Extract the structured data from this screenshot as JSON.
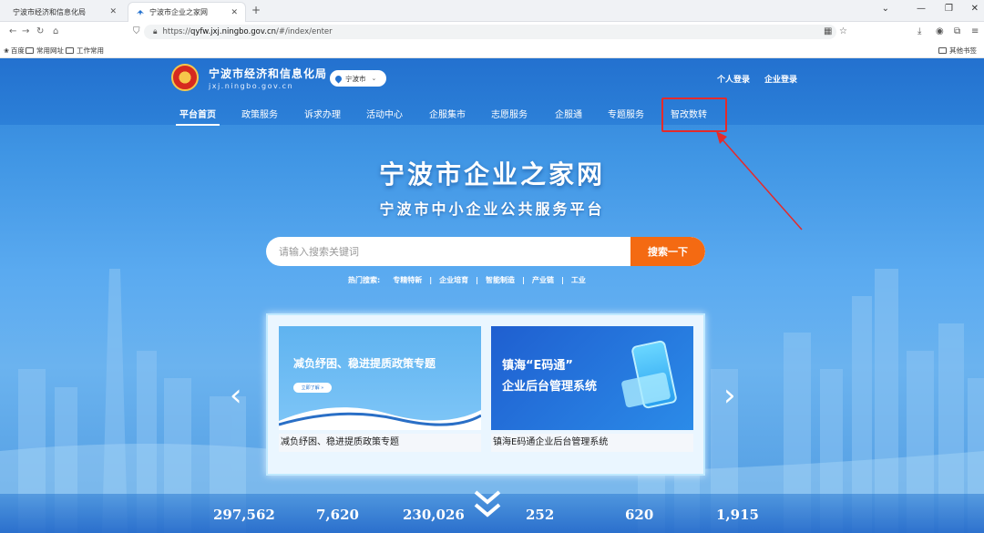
{
  "browser": {
    "tabs": [
      {
        "label": "宁波市经济和信息化局"
      },
      {
        "label": "宁波市企业之家网"
      }
    ],
    "url_scheme": "https://",
    "url_host": "qyfw.jxj.ningbo.gov.cn",
    "url_path": "/#/index/enter",
    "bookmarks": [
      {
        "label": "百度"
      },
      {
        "label": "常用网址"
      },
      {
        "label": "工作常用"
      },
      {
        "label": "其他书签"
      }
    ]
  },
  "header": {
    "site_title": "宁波市经济和信息化局",
    "site_domain": "jxj.ningbo.gov.cn",
    "city_select": "宁波市",
    "personal_login": "个人登录",
    "enterprise_login": "企业登录"
  },
  "nav": {
    "items": [
      {
        "label": "平台首页"
      },
      {
        "label": "政策服务"
      },
      {
        "label": "诉求办理"
      },
      {
        "label": "活动中心"
      },
      {
        "label": "企服集市"
      },
      {
        "label": "志愿服务"
      },
      {
        "label": "企服通"
      },
      {
        "label": "专题服务"
      },
      {
        "label": "智改数转"
      }
    ]
  },
  "hero": {
    "title": "宁波市企业之家网",
    "subtitle": "宁波市中小企业公共服务平台",
    "search_placeholder": "请输入搜索关键词",
    "search_button": "搜索一下",
    "hot_label": "热门搜索:",
    "hot_terms": [
      "专精特新",
      "企业培育",
      "智能制造",
      "产业链",
      "工业"
    ]
  },
  "carousel": {
    "cards": [
      {
        "image_text": "减负纾困、稳进提质政策专题",
        "image_button": "立即了解 »",
        "caption": "减负纾困、稳进提质政策专题"
      },
      {
        "image_text_1": "镇海“E码通”",
        "image_text_2": "企业后台管理系统",
        "caption": "镇海E码通企业后台管理系统"
      }
    ]
  },
  "stats": [
    {
      "value": "297,562"
    },
    {
      "value": "7,620"
    },
    {
      "value": "230,026"
    },
    {
      "value": "252"
    },
    {
      "value": "620"
    },
    {
      "value": "1,915"
    }
  ],
  "colors": {
    "header_blue": "#2371cf",
    "search_orange": "#f46a12",
    "highlight_red": "#e52a2a"
  }
}
